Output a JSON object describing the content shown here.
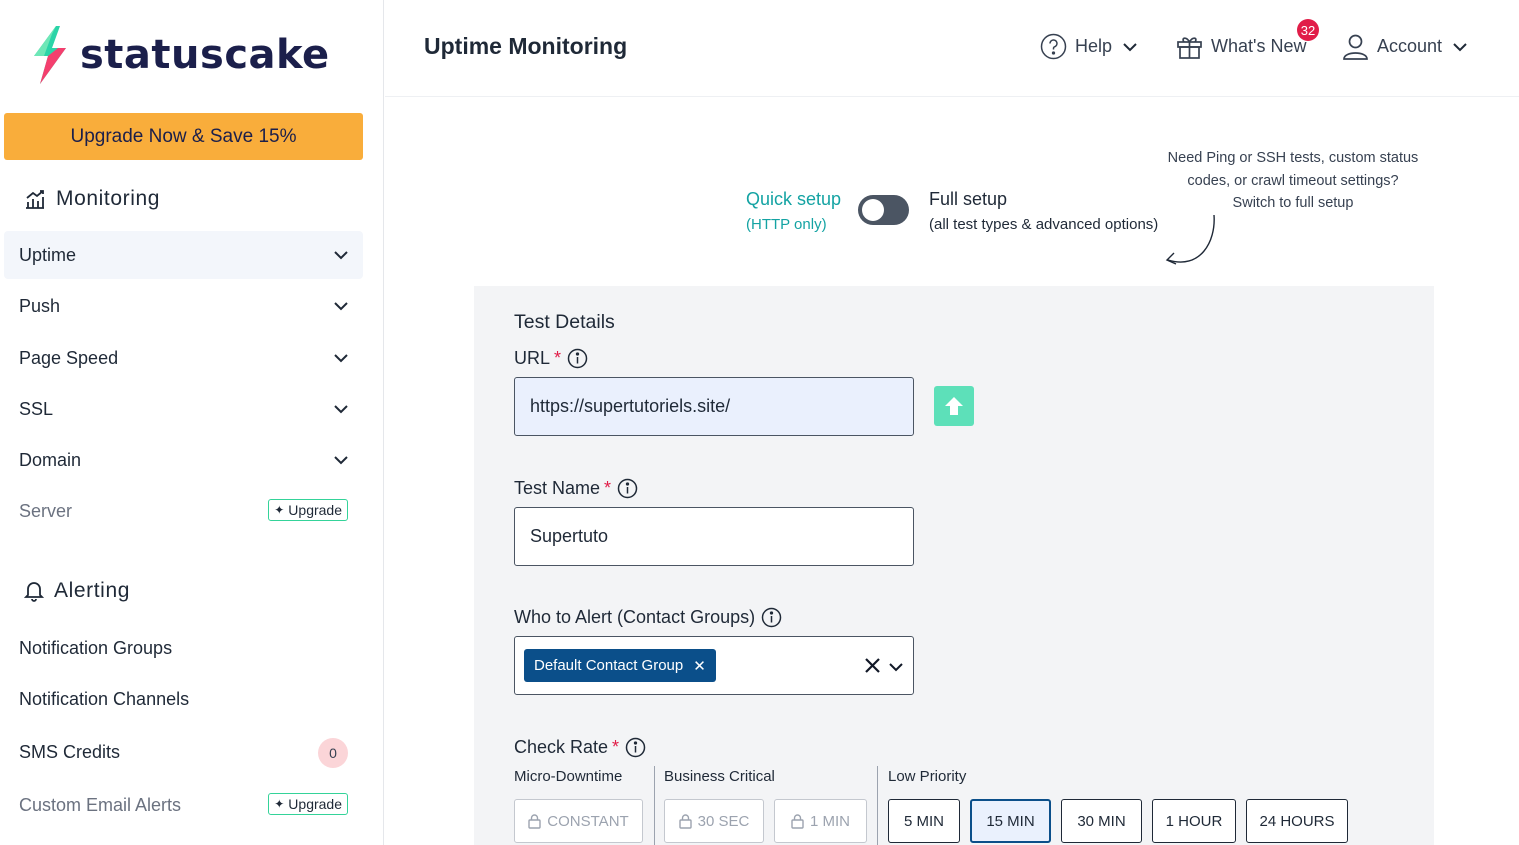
{
  "brand": {
    "name": "statuscake"
  },
  "sidebar": {
    "upgrade_label": "Upgrade Now & Save 15%",
    "monitoring_title": "Monitoring",
    "monitoring_items": [
      {
        "label": "Uptime"
      },
      {
        "label": "Push"
      },
      {
        "label": "Page Speed"
      },
      {
        "label": "SSL"
      },
      {
        "label": "Domain"
      },
      {
        "label": "Server",
        "badge": "Upgrade"
      }
    ],
    "alerting_title": "Alerting",
    "alerting_items": [
      {
        "label": "Notification Groups"
      },
      {
        "label": "Notification Channels"
      },
      {
        "label": "SMS Credits",
        "count": "0"
      },
      {
        "label": "Custom Email Alerts",
        "badge": "Upgrade"
      }
    ]
  },
  "header": {
    "title": "Uptime Monitoring",
    "help_label": "Help",
    "whats_new_label": "What's New",
    "whats_new_count": "32",
    "account_label": "Account"
  },
  "setup": {
    "quick_label": "Quick setup",
    "quick_sub": "(HTTP only)",
    "full_label": "Full setup",
    "full_sub": "(all test types & advanced options)",
    "hint_line1": "Need Ping or SSH tests, custom status",
    "hint_line2": "codes, or crawl timeout settings?",
    "hint_line3": "Switch to full setup"
  },
  "form": {
    "title": "Test Details",
    "url_label": "URL",
    "url_value": "https://supertutoriels.site/",
    "name_label": "Test Name",
    "name_value": "Supertuto",
    "contact_label": "Who to Alert (Contact Groups)",
    "contact_chip": "Default Contact Group",
    "check_rate_label": "Check Rate",
    "groups": {
      "micro": "Micro-Downtime",
      "business": "Business Critical",
      "low": "Low Priority"
    },
    "rates": {
      "constant": "CONSTANT",
      "sec30": "30 SEC",
      "min1": "1 MIN",
      "min5": "5 MIN",
      "min15": "15 MIN",
      "min30": "30 MIN",
      "hour1": "1 HOUR",
      "hours24": "24 HOURS"
    }
  },
  "colors": {
    "accent_orange": "#f9ad3b",
    "teal": "#14a3a3",
    "navy": "#0b4f8a",
    "required_red": "#e11d48",
    "submit_green": "#5de0b9"
  }
}
